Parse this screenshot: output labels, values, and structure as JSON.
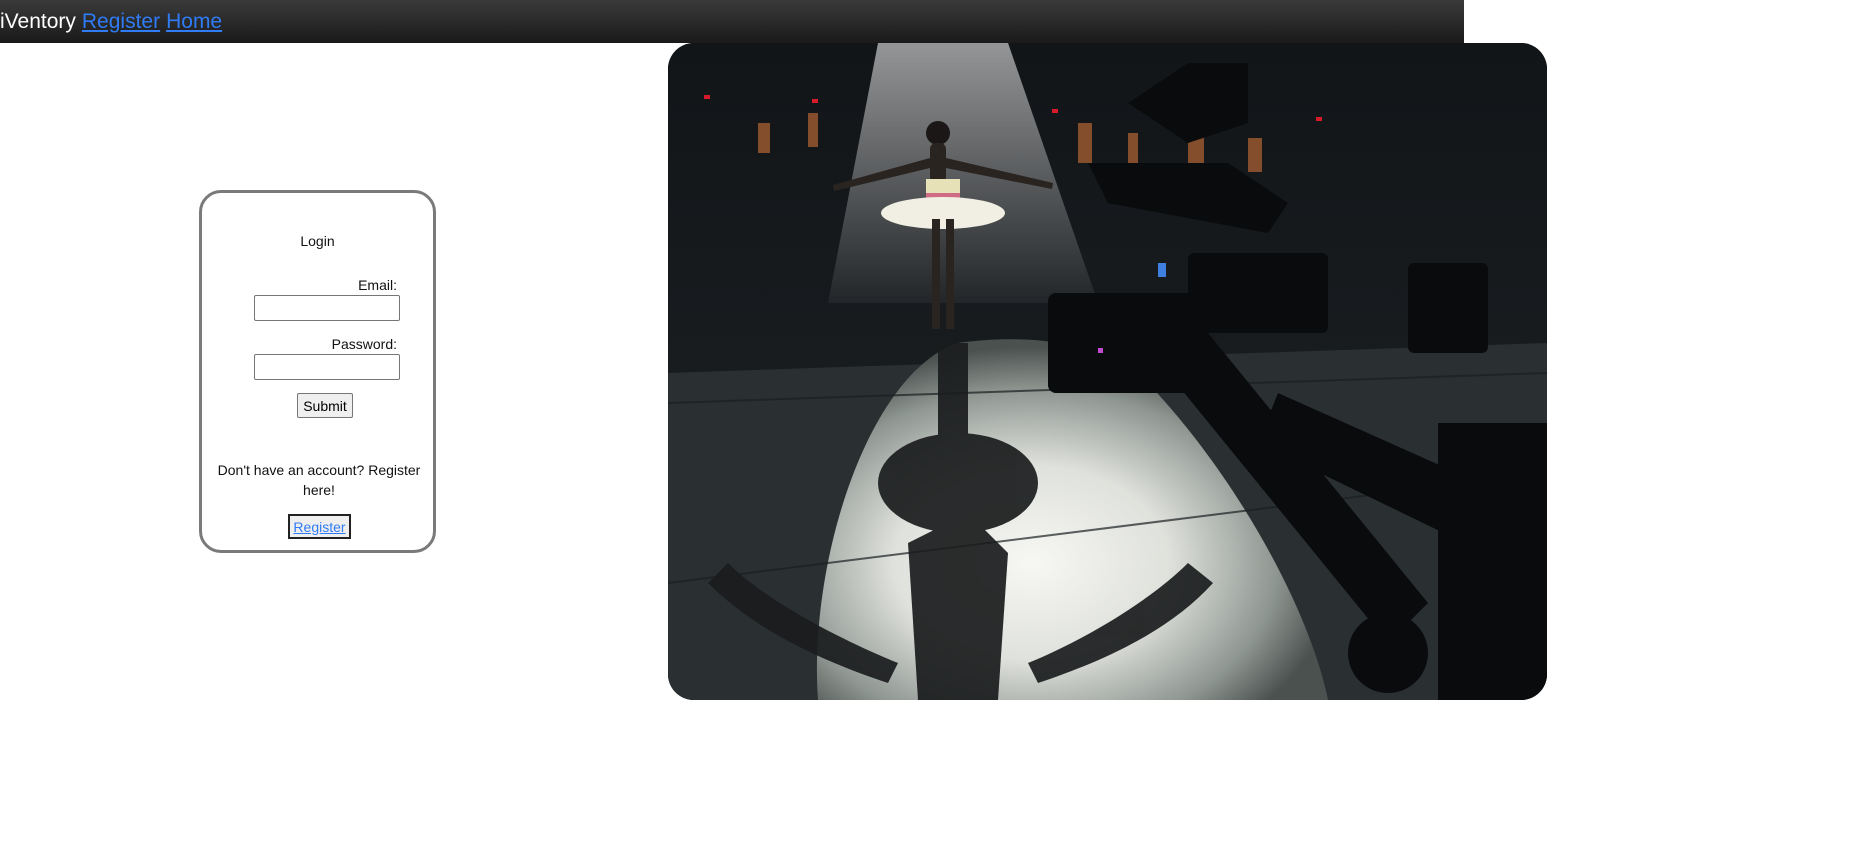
{
  "navbar": {
    "brand": "iVentory",
    "links": [
      "Register",
      "Home"
    ]
  },
  "login": {
    "title": "Login",
    "email_label": "Email:",
    "email_value": "",
    "password_label": "Password:",
    "password_value": "",
    "submit_label": "Submit",
    "register_prompt": "Don't have an account? Register here!",
    "register_label": "Register"
  },
  "hero": {
    "description_icon": "ballerina-stage-photo",
    "colors": {
      "topbar": "#1a1a1a",
      "link": "#2f7cf6",
      "card_border": "#7a7a7a"
    }
  }
}
